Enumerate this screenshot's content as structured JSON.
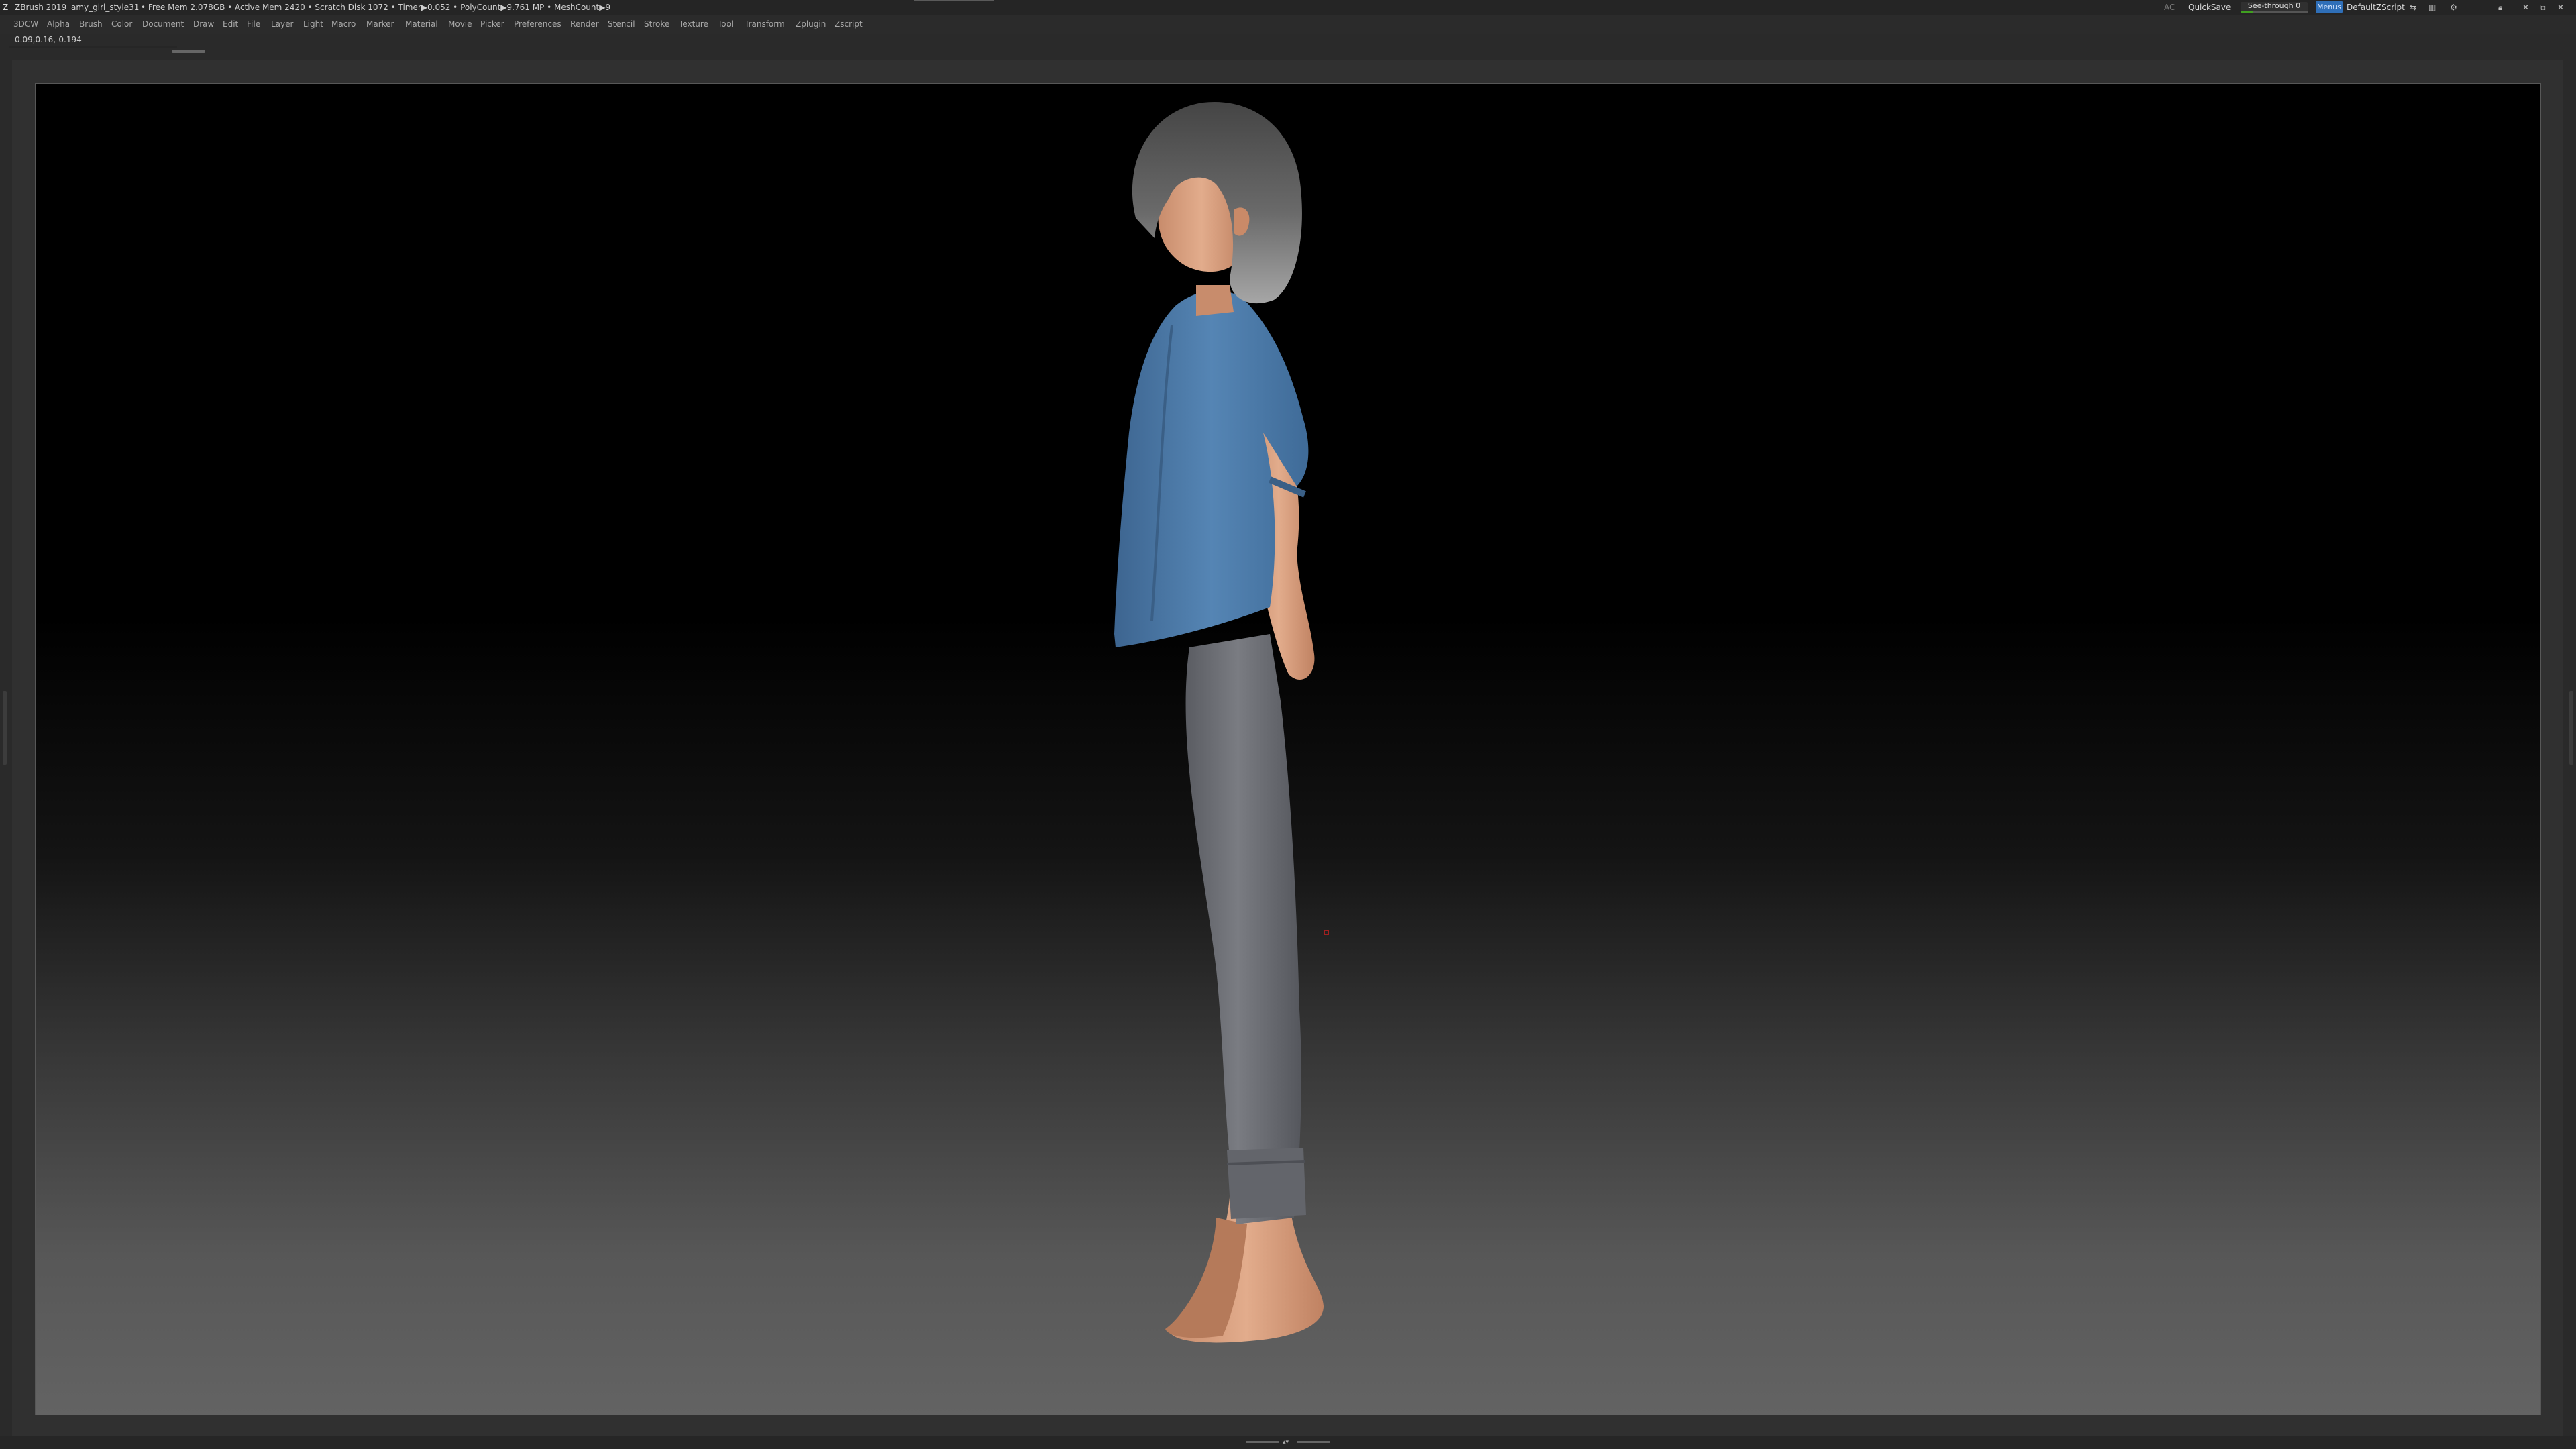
{
  "titlebar": {
    "app_name": "ZBrush 2019",
    "document": "amy_girl_style31",
    "stats": "• Free Mem 2.078GB • Active Mem 2420 • Scratch Disk 1072 • Timer▶0.052 • PolyCount▶9.761 MP • MeshCount▶9",
    "ac": "AC",
    "quicksave": "QuickSave",
    "see_through": "See-through  0",
    "see_through_value": 0,
    "menus": "Menus",
    "default_zscript": "DefaultZScript",
    "icons": [
      "help-icon",
      "layout-icon",
      "settings-icon",
      "lock-icon",
      "minimize-icon",
      "maximize-icon",
      "close-icon"
    ]
  },
  "menubar": {
    "items": [
      "3DCW",
      "Alpha",
      "Brush",
      "Color",
      "Document",
      "Draw",
      "Edit",
      "File",
      "Layer",
      "Light",
      "Macro",
      "Marker",
      "Material",
      "Movie",
      "Picker",
      "Preferences",
      "Render",
      "Stencil",
      "Stroke",
      "Texture",
      "Tool",
      "Transform",
      "Zplugin",
      "Zscript"
    ]
  },
  "info": {
    "coords": "0.09,0.16,-0.194"
  },
  "canvas": {
    "subject": "stylized-girl-3d-model",
    "colors": {
      "shirt": "#4f7ca8",
      "pants": "#6c6e74",
      "skin": "#d69d7e",
      "hair_top": "#4a4a4a",
      "hair_bottom": "#9a9a9a",
      "background_top": "#000000",
      "background_bottom": "#636363"
    }
  }
}
